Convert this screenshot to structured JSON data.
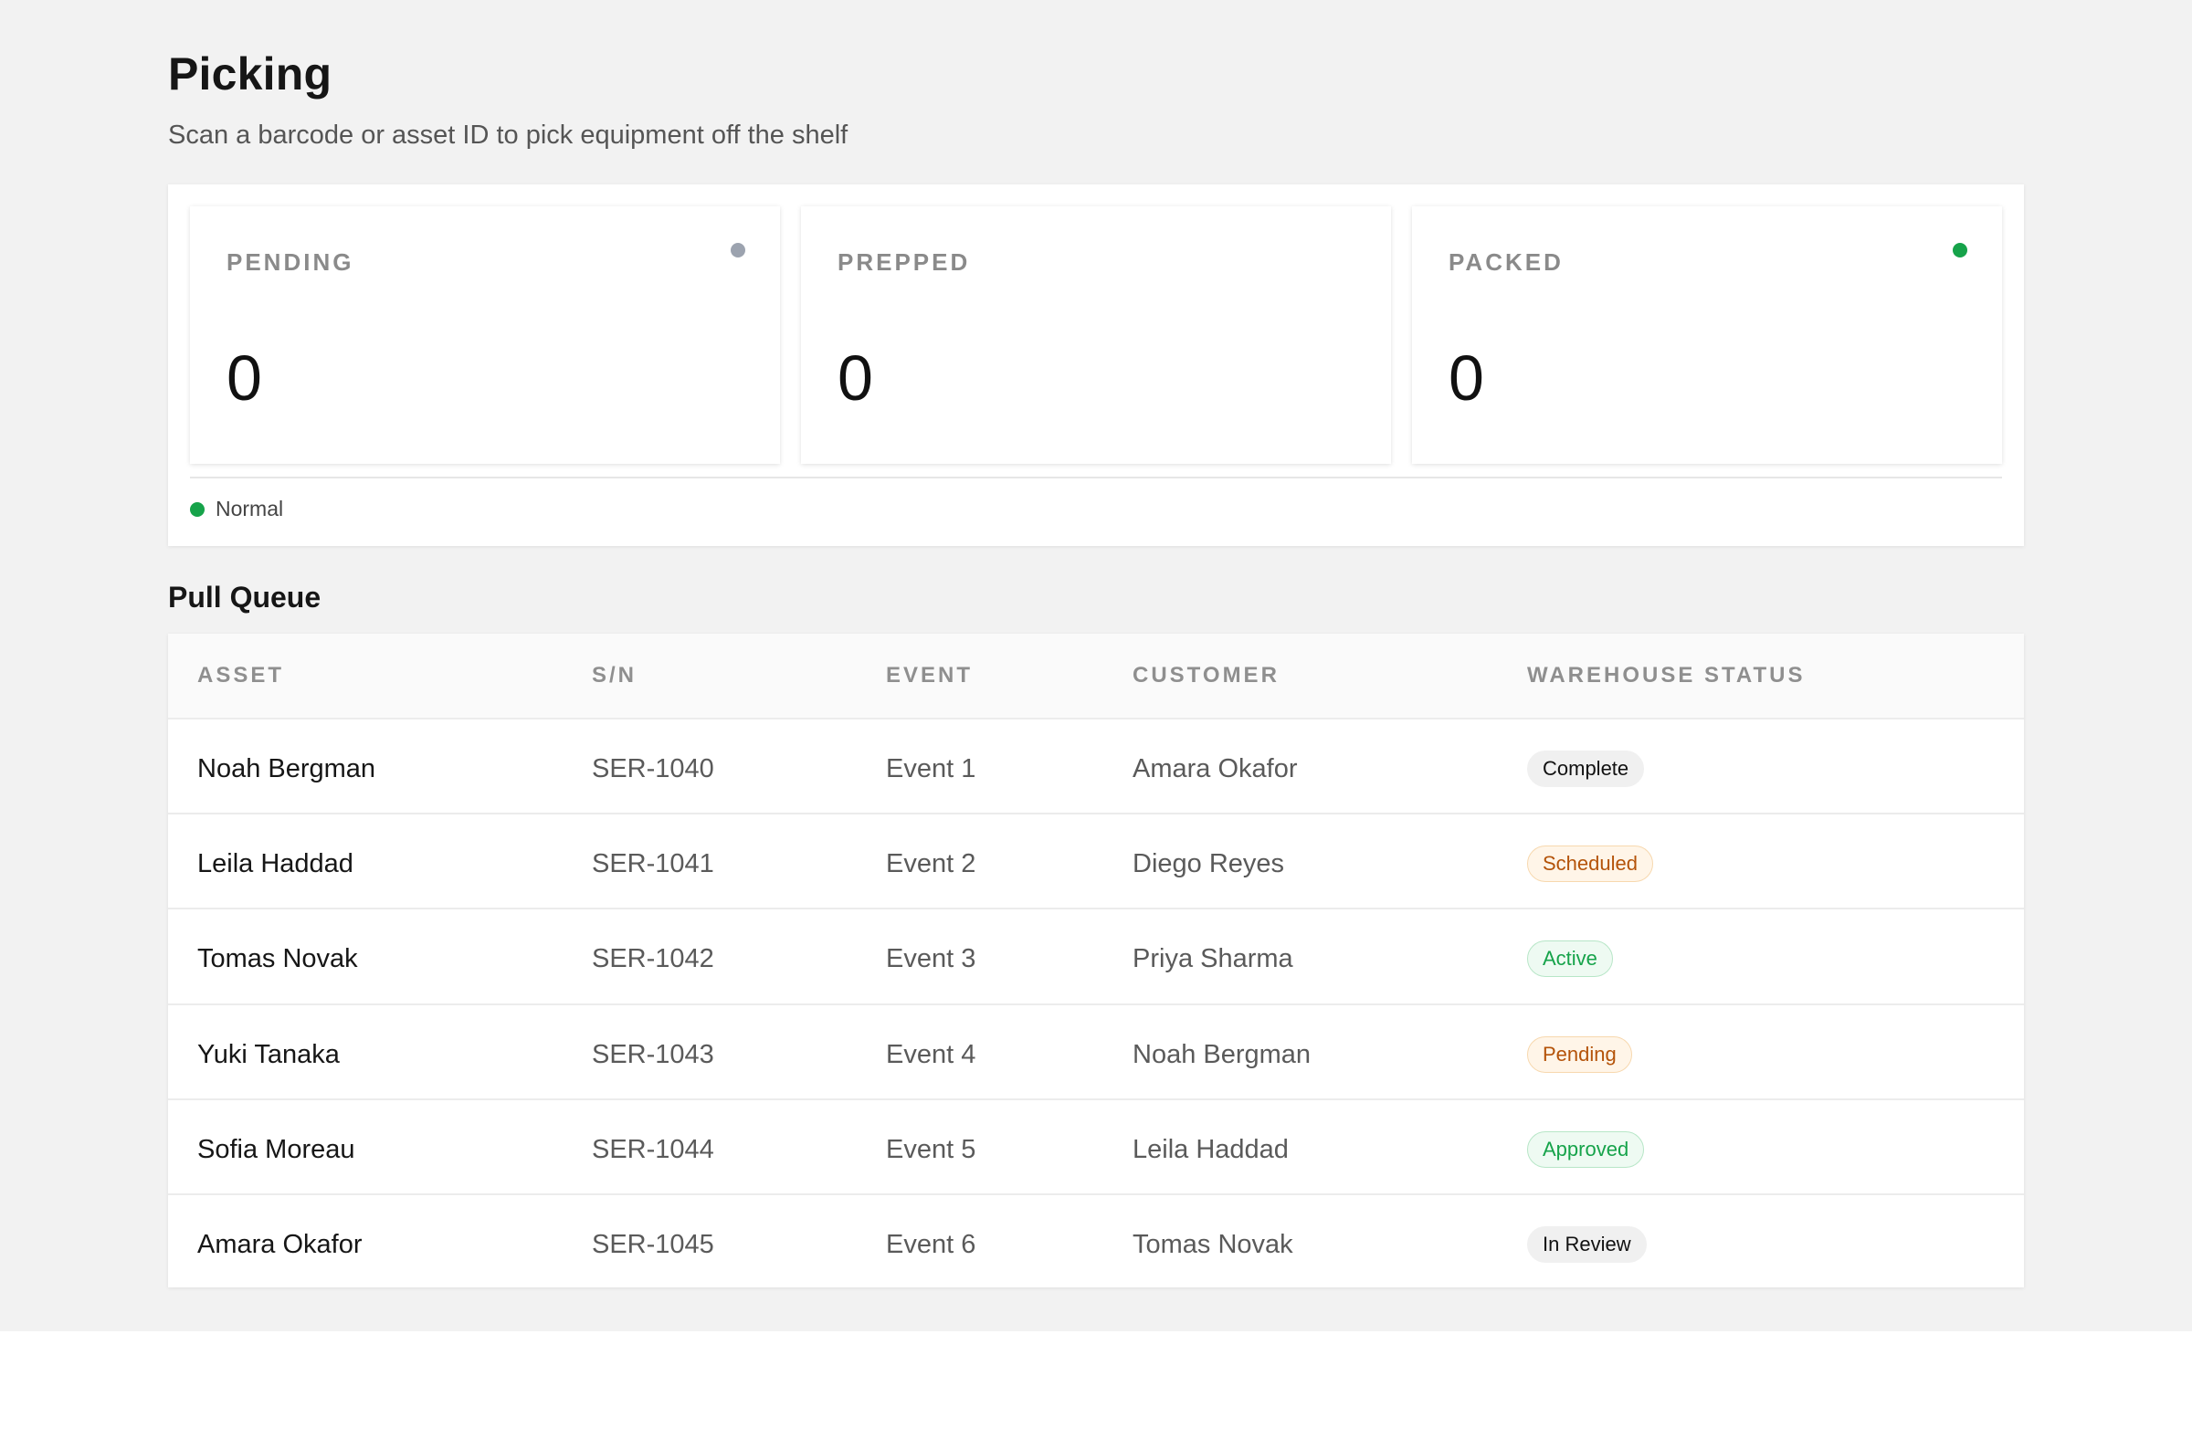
{
  "header": {
    "title": "Picking",
    "subtitle": "Scan a barcode or asset ID to pick equipment off the shelf"
  },
  "stats": [
    {
      "label": "PENDING",
      "value": "0",
      "indicator_color": "#9ca3af"
    },
    {
      "label": "PREPPED",
      "value": "0",
      "indicator_color": ""
    },
    {
      "label": "PACKED",
      "value": "0",
      "indicator_color": "#16a34a"
    }
  ],
  "legend": {
    "label": "Normal",
    "color": "#16a34a"
  },
  "queue": {
    "title": "Pull Queue",
    "columns": [
      "ASSET",
      "S/N",
      "EVENT",
      "CUSTOMER",
      "WAREHOUSE STATUS"
    ],
    "rows": [
      {
        "asset": "Noah Bergman",
        "sn": "SER-1040",
        "event": "Event 1",
        "customer": "Amara Okafor",
        "status": "Complete",
        "tone": "neutral"
      },
      {
        "asset": "Leila Haddad",
        "sn": "SER-1041",
        "event": "Event 2",
        "customer": "Diego Reyes",
        "status": "Scheduled",
        "tone": "warn"
      },
      {
        "asset": "Tomas Novak",
        "sn": "SER-1042",
        "event": "Event 3",
        "customer": "Priya Sharma",
        "status": "Active",
        "tone": "ok"
      },
      {
        "asset": "Yuki Tanaka",
        "sn": "SER-1043",
        "event": "Event 4",
        "customer": "Noah Bergman",
        "status": "Pending",
        "tone": "warn"
      },
      {
        "asset": "Sofia Moreau",
        "sn": "SER-1044",
        "event": "Event 5",
        "customer": "Leila Haddad",
        "status": "Approved",
        "tone": "ok"
      },
      {
        "asset": "Amara Okafor",
        "sn": "SER-1045",
        "event": "Event 6",
        "customer": "Tomas Novak",
        "status": "In Review",
        "tone": "neutral"
      }
    ]
  }
}
